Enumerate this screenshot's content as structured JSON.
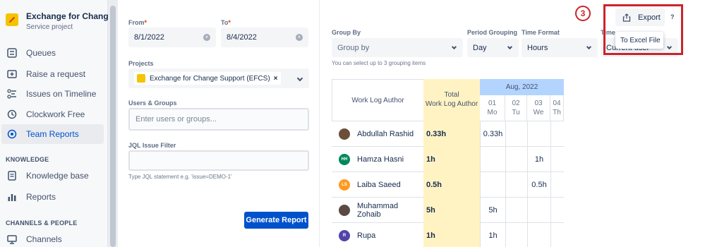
{
  "sidebar": {
    "project_name": "Exchange for Change S...",
    "project_type": "Service project",
    "items": [
      {
        "label": "Queues",
        "icon": "queues-icon"
      },
      {
        "label": "Raise a request",
        "icon": "raise-request-icon"
      },
      {
        "label": "Issues on Timeline",
        "icon": "timeline-icon"
      },
      {
        "label": "Clockwork Free",
        "icon": "clock-icon"
      },
      {
        "label": "Team Reports",
        "icon": "team-reports-icon",
        "active": true
      }
    ],
    "knowledge_title": "KNOWLEDGE",
    "knowledge_items": [
      {
        "label": "Knowledge base",
        "icon": "knowledge-base-icon"
      },
      {
        "label": "Reports",
        "icon": "reports-icon"
      }
    ],
    "channels_title": "CHANNELS & PEOPLE",
    "channels_items": [
      {
        "label": "Channels",
        "icon": "channels-icon"
      }
    ]
  },
  "form": {
    "from_label": "From",
    "from_value": "8/1/2022",
    "to_label": "To",
    "to_value": "8/4/2022",
    "projects_label": "Projects",
    "project_chip": "Exchange for Change Support (EFCS)",
    "users_label": "Users & Groups",
    "users_placeholder": "Enter users or groups...",
    "jql_label": "JQL Issue Filter",
    "jql_hint": "Type JQL statement e.g. 'issue=DEMO-1'",
    "generate_label": "Generate Report"
  },
  "controls": {
    "group_by_label": "Group By",
    "group_by_value": "Group by",
    "group_by_hint": "You can select up to 3 grouping items",
    "period_label": "Period Grouping",
    "period_value": "Day",
    "time_format_label": "Time Format",
    "time_format_value": "Hours",
    "timezone_label": "Time",
    "timezone_value": "Current user",
    "export_label": "Export",
    "export_option": "To Excel File",
    "help_label": "?",
    "step_number": "3"
  },
  "table": {
    "author_header": "Work Log Author",
    "total_header_line1": "Total",
    "total_header_line2": "Work Log Author",
    "month_header": "Aug, 2022",
    "days": [
      {
        "num": "01",
        "dow": "Mo"
      },
      {
        "num": "02",
        "dow": "Tu"
      },
      {
        "num": "03",
        "dow": "We"
      },
      {
        "num": "04",
        "dow": "Th"
      }
    ],
    "rows": [
      {
        "name": "Abdullah Rashid",
        "initials": "",
        "avatar_color": "#6b4f3a",
        "total": "0.33h",
        "days": [
          "0.33h",
          "",
          "",
          ""
        ]
      },
      {
        "name": "Hamza Hasni",
        "initials": "HH",
        "avatar_color": "#00875a",
        "total": "1h",
        "days": [
          "",
          "",
          "1h",
          ""
        ]
      },
      {
        "name": "Laiba Saeed",
        "initials": "LS",
        "avatar_color": "#ff991f",
        "total": "0.5h",
        "days": [
          "",
          "",
          "0.5h",
          ""
        ]
      },
      {
        "name": "Muhammad Zohaib",
        "initials": "",
        "avatar_color": "#5a4a42",
        "total": "5h",
        "days": [
          "5h",
          "",
          "",
          ""
        ]
      },
      {
        "name": "Rupa",
        "initials": "R",
        "avatar_color": "#5243aa",
        "total": "1h",
        "days": [
          "1h",
          "",
          "",
          ""
        ]
      }
    ]
  },
  "colors": {
    "accent": "#0052cc",
    "highlight": "#c9252c",
    "total_column": "#fff3c4",
    "month_header": "#b3d4ff"
  }
}
